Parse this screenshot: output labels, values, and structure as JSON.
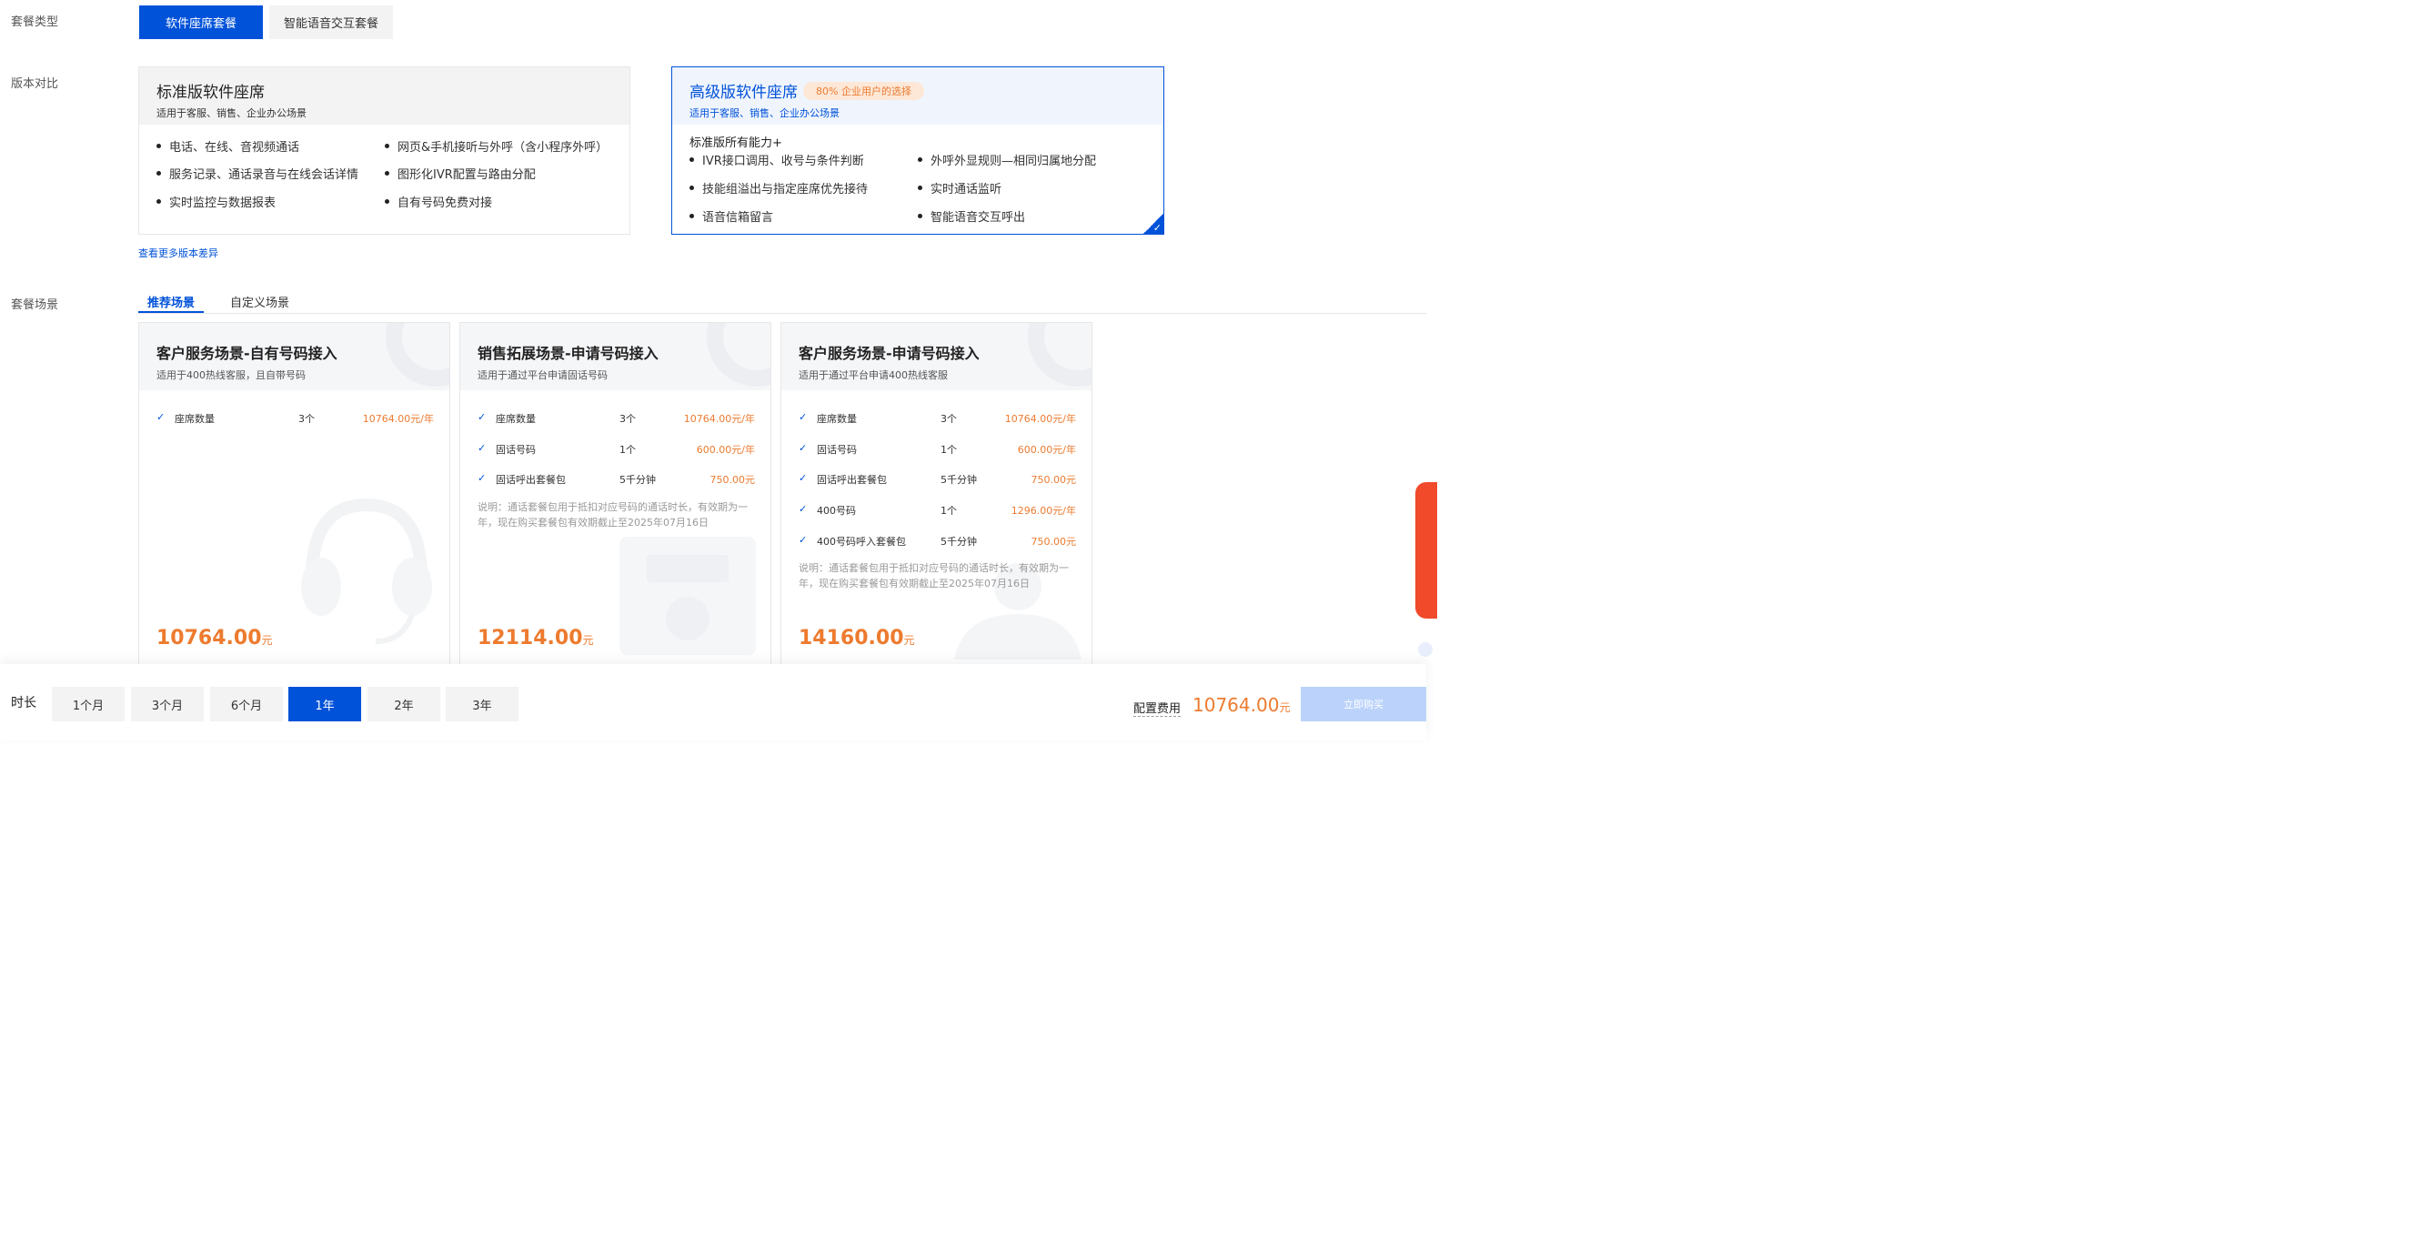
{
  "labels": {
    "package_type": "套餐类型",
    "version_compare": "版本对比",
    "scenario": "套餐场景",
    "duration": "时长"
  },
  "package_types": [
    "软件座席套餐",
    "智能语音交互套餐"
  ],
  "versions": {
    "standard": {
      "title": "标准版软件座席",
      "subtitle": "适用于客服、销售、企业办公场景",
      "features": [
        "电话、在线、音视频通话",
        "网页&手机接听与外呼（含小程序外呼）",
        "服务记录、通话录音与在线会话详情",
        "图形化IVR配置与路由分配",
        "实时监控与数据报表",
        "自有号码免费对接"
      ]
    },
    "premium": {
      "title": "高级版软件座席",
      "badge": "80% 企业用户的选择",
      "subtitle": "适用于客服、销售、企业办公场景",
      "plus_title": "标准版所有能力+",
      "features": [
        "IVR接口调用、收号与条件判断",
        "外呼外显规则—相同归属地分配",
        "技能组溢出与指定座席优先接待",
        "实时通话监听",
        "语音信箱留言",
        "智能语音交互呼出"
      ]
    }
  },
  "more_link": "查看更多版本差异",
  "tabs": [
    "推荐场景",
    "自定义场景"
  ],
  "scenarios": [
    {
      "title": "客户服务场景-自有号码接入",
      "subtitle": "适用于400热线客服，且自带号码",
      "items": [
        {
          "name": "座席数量",
          "qty": "3个",
          "price": "10764.00元/年"
        }
      ],
      "note": "",
      "total": "10764.00",
      "unit": "元"
    },
    {
      "title": "销售拓展场景-申请号码接入",
      "subtitle": "适用于通过平台申请固话号码",
      "items": [
        {
          "name": "座席数量",
          "qty": "3个",
          "price": "10764.00元/年"
        },
        {
          "name": "固话号码",
          "qty": "1个",
          "price": "600.00元/年"
        },
        {
          "name": "固话呼出套餐包",
          "qty": "5千分钟",
          "price": "750.00元"
        }
      ],
      "note": "说明：通话套餐包用于抵扣对应号码的通话时长，有效期为一年，现在购买套餐包有效期截止至2025年07月16日",
      "total": "12114.00",
      "unit": "元"
    },
    {
      "title": "客户服务场景-申请号码接入",
      "subtitle": "适用于通过平台申请400热线客服",
      "items": [
        {
          "name": "座席数量",
          "qty": "3个",
          "price": "10764.00元/年"
        },
        {
          "name": "固话号码",
          "qty": "1个",
          "price": "600.00元/年"
        },
        {
          "name": "固话呼出套餐包",
          "qty": "5千分钟",
          "price": "750.00元"
        },
        {
          "name": "400号码",
          "qty": "1个",
          "price": "1296.00元/年"
        },
        {
          "name": "400号码呼入套餐包",
          "qty": "5千分钟",
          "price": "750.00元"
        }
      ],
      "note": "说明：通话套餐包用于抵扣对应号码的通话时长，有效期为一年，现在购买套餐包有效期截止至2025年07月16日",
      "total": "14160.00",
      "unit": "元"
    }
  ],
  "durations": [
    "1个月",
    "3个月",
    "6个月",
    "1年",
    "2年",
    "3年"
  ],
  "selected_duration": "1年",
  "fee": {
    "label": "配置费用",
    "value": "10764.00",
    "unit": "元"
  },
  "buy_button": "立即购买",
  "colors": {
    "primary": "#0052d9",
    "accent_orange": "#ed7b2f",
    "badge_bg": "#fde8d8"
  }
}
